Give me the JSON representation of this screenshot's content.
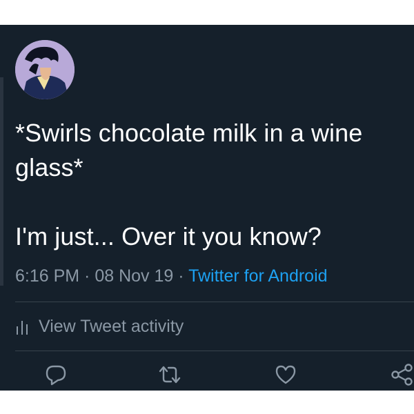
{
  "tweet": {
    "text": "*Swirls chocolate milk in a wine glass*\n\nI'm just... Over it you know?",
    "time": "6:16 PM",
    "separator": " · ",
    "date": "08 Nov 19",
    "source": "Twitter for Android",
    "activity_label": "View Tweet activity"
  },
  "actions": {
    "icons": [
      "reply-icon",
      "retweet-icon",
      "like-icon",
      "share-icon"
    ]
  },
  "colors": {
    "background": "#15202b",
    "text": "#ffffff",
    "secondary_text": "#8b98a5",
    "link": "#1da1f2",
    "divider": "#38444d"
  }
}
